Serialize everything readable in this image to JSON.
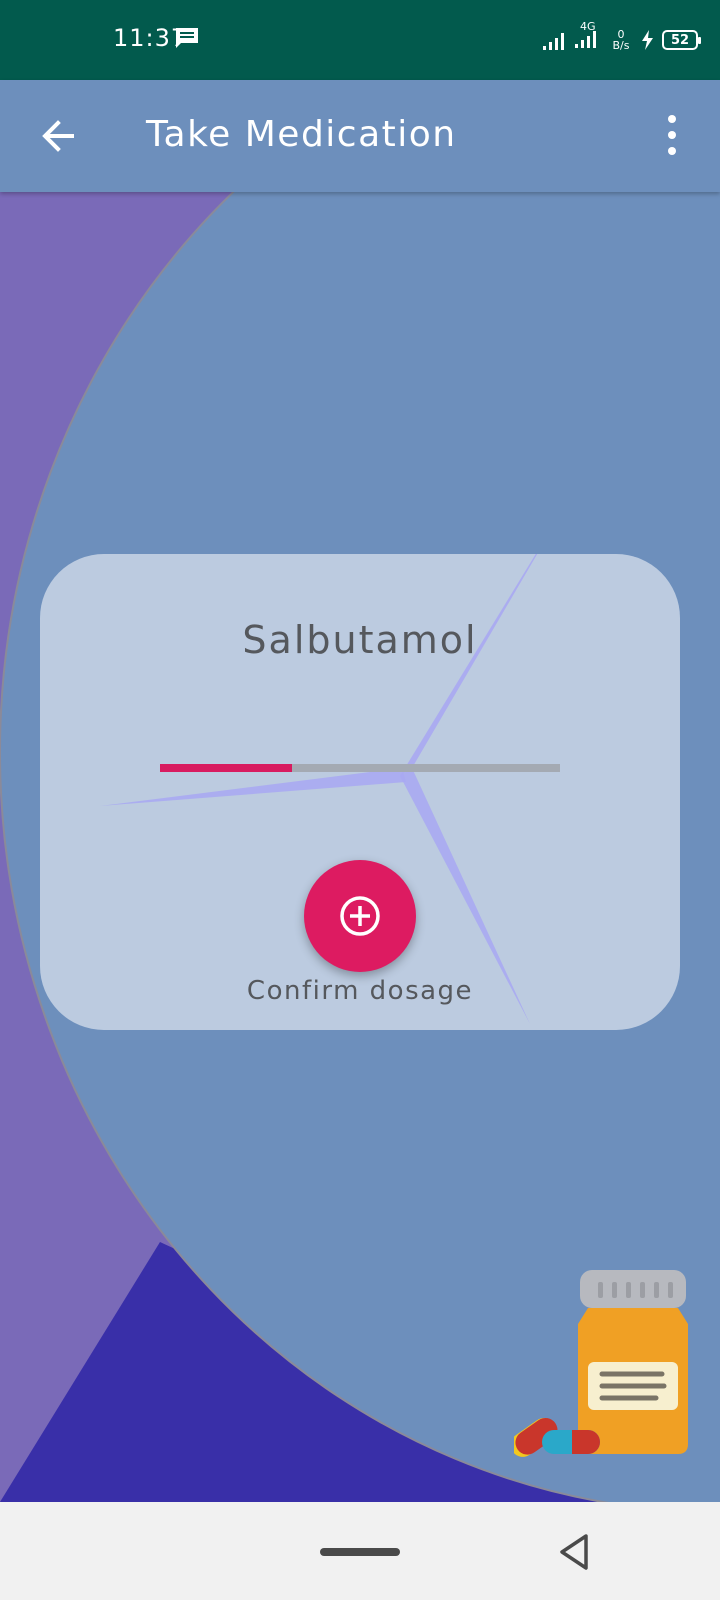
{
  "status_bar": {
    "time": "11:37",
    "network_label": "4G",
    "speed_value": "0",
    "speed_unit": "B/s",
    "battery": "52",
    "icons": [
      "message-icon",
      "signal-icon",
      "signal-4g-icon",
      "charging-icon",
      "battery-icon"
    ]
  },
  "app_bar": {
    "title": "Take Medication",
    "icons": [
      "arrow-back-icon",
      "more-vert-icon"
    ]
  },
  "card": {
    "medication_name": "Salbutamol",
    "dosage_progress": 0.33,
    "confirm_label": "Confirm dosage",
    "icons": [
      "add-circle-icon"
    ]
  },
  "decoration": {
    "icons": [
      "medicine-bottle-icon",
      "pills-icon"
    ]
  },
  "colors": {
    "status_bar": "#025a4d",
    "app_bar": "#6d8fbc",
    "accent": "#dd1b61",
    "background_purple": "#7a6ab8",
    "background_dark_purple": "#392fa8"
  }
}
